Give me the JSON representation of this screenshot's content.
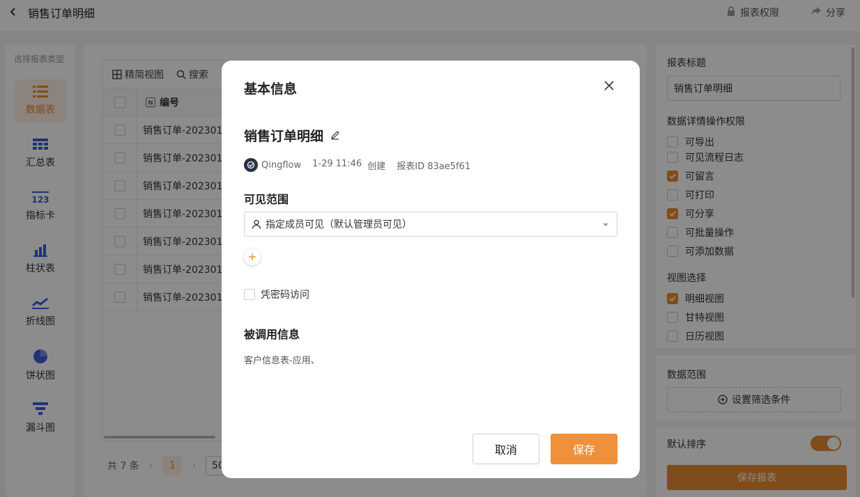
{
  "header": {
    "title": "销售订单明细",
    "permission_label": "报表权限",
    "share_label": "分享"
  },
  "type_panel": {
    "title": "选择报表类型",
    "items": [
      {
        "label": "数据表",
        "icon": "list-icon"
      },
      {
        "label": "汇总表",
        "icon": "table-icon"
      },
      {
        "label": "指标卡",
        "icon": "number-card-icon"
      },
      {
        "label": "柱状表",
        "icon": "bar-chart-icon"
      },
      {
        "label": "折线图",
        "icon": "line-chart-icon"
      },
      {
        "label": "饼状图",
        "icon": "pie-chart-icon"
      },
      {
        "label": "漏斗图",
        "icon": "funnel-icon"
      }
    ],
    "active": "数据表"
  },
  "table": {
    "toolbar": {
      "compact_view": "精简视图",
      "search": "搜索"
    },
    "column_header": "编号",
    "rows": [
      "销售订单-202301",
      "销售订单-202301",
      "销售订单-202301",
      "销售订单-202301",
      "销售订单-202301",
      "销售订单-202301",
      "销售订单-202301"
    ],
    "pager": {
      "total": "共 7 条",
      "page": "1",
      "page_size": "50"
    }
  },
  "right_panel": {
    "report_title_label": "报表标题",
    "report_title_value": "销售订单明细",
    "perm_label": "数据详情操作权限",
    "perms": [
      {
        "label": "可导出",
        "checked": false
      },
      {
        "label": "可见流程日志",
        "checked": false
      },
      {
        "label": "可留言",
        "checked": true
      },
      {
        "label": "可打印",
        "checked": false
      },
      {
        "label": "可分享",
        "checked": true
      },
      {
        "label": "可批量操作",
        "checked": false
      },
      {
        "label": "可添加数据",
        "checked": false
      }
    ],
    "view_label": "视图选择",
    "views": [
      {
        "label": "明细视图",
        "checked": true
      },
      {
        "label": "甘特视图",
        "checked": false
      },
      {
        "label": "日历视图",
        "checked": false
      }
    ],
    "data_range_label": "数据范围",
    "filter_button": "设置筛选条件",
    "default_sort_label": "默认排序",
    "default_sort_on": true,
    "save_report": "保存报表"
  },
  "modal": {
    "title": "基本信息",
    "report_name": "销售订单明细",
    "creator": "Qingflow",
    "created_time": "1-29 11:46",
    "created_suffix": "创建",
    "report_id": "报表ID 83ae5f61",
    "visibility_label": "可见范围",
    "visibility_value": "指定成员可见（默认管理员可见）",
    "password_access": "凭密码访问",
    "ref_info_label": "被调用信息",
    "ref_info_value": "客户信息表-应用、",
    "cancel": "取消",
    "save": "保存"
  },
  "colors": {
    "accent": "#ef913a",
    "accent_light": "#fdefe2",
    "icon_blue": "#3d5bd9"
  }
}
